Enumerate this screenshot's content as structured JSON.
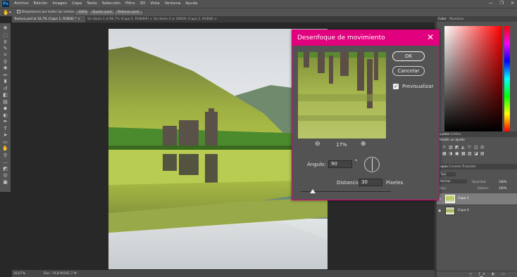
{
  "app": {
    "logo": "Ps"
  },
  "menubar": {
    "items": [
      "Archivo",
      "Edición",
      "Imagen",
      "Capa",
      "Texto",
      "Selección",
      "Filtro",
      "3D",
      "Vista",
      "Ventana",
      "Ayuda"
    ],
    "window_controls": [
      "—",
      "❐",
      "✕"
    ]
  },
  "options": {
    "scroll_all": "Desplazarse por todas las ventanas",
    "zoom_100": "100%",
    "fit_screen": "Ajustar pant.",
    "fill_screen": "Rellenar pant."
  },
  "tabs": [
    {
      "label": "Textura.psd al 16,7% (Capa 1, RGB/8) * ×",
      "active": true
    },
    {
      "label": "Sin título-1 al 66,7% (Capa 5, RGB/8#) ×",
      "active": false
    },
    {
      "label": "Sin título-2 al 1600% (Capa 2, RGB/8) ×",
      "active": false
    }
  ],
  "status": {
    "zoom": "16,67%",
    "doc": "Doc: 74,8 M/161,7 M"
  },
  "dialog": {
    "title": "Desenfoque de movimiento",
    "ok": "OK",
    "cancel": "Cancelar",
    "preview_label": "Previsualizar",
    "preview_checked": true,
    "zoom_level": "17%",
    "angle_label": "Ángulo:",
    "angle_value": "90",
    "angle_unit": "°",
    "distance_label": "Distancia:",
    "distance_value": "30",
    "distance_unit": "Píxeles",
    "accent_color": "#e1007e"
  },
  "panels": {
    "color_tabs": [
      "Color",
      "Muestras"
    ],
    "adjust_tabs": [
      "Ajustes",
      "Estilos"
    ],
    "adjust_label": "Añadir un ajuste",
    "layers_tabs": [
      "Capas",
      "Canales",
      "Trazados"
    ],
    "kind_label": "Tipo",
    "blend_mode": "Normal",
    "opacity_label": "Opacidad:",
    "opacity_value": "100%",
    "lock_label": "Bloq.:",
    "fill_label": "Relleno:",
    "fill_value": "100%",
    "layers": [
      {
        "name": "Capa 1",
        "selected": true
      },
      {
        "name": "Capa 0",
        "selected": false
      }
    ]
  }
}
